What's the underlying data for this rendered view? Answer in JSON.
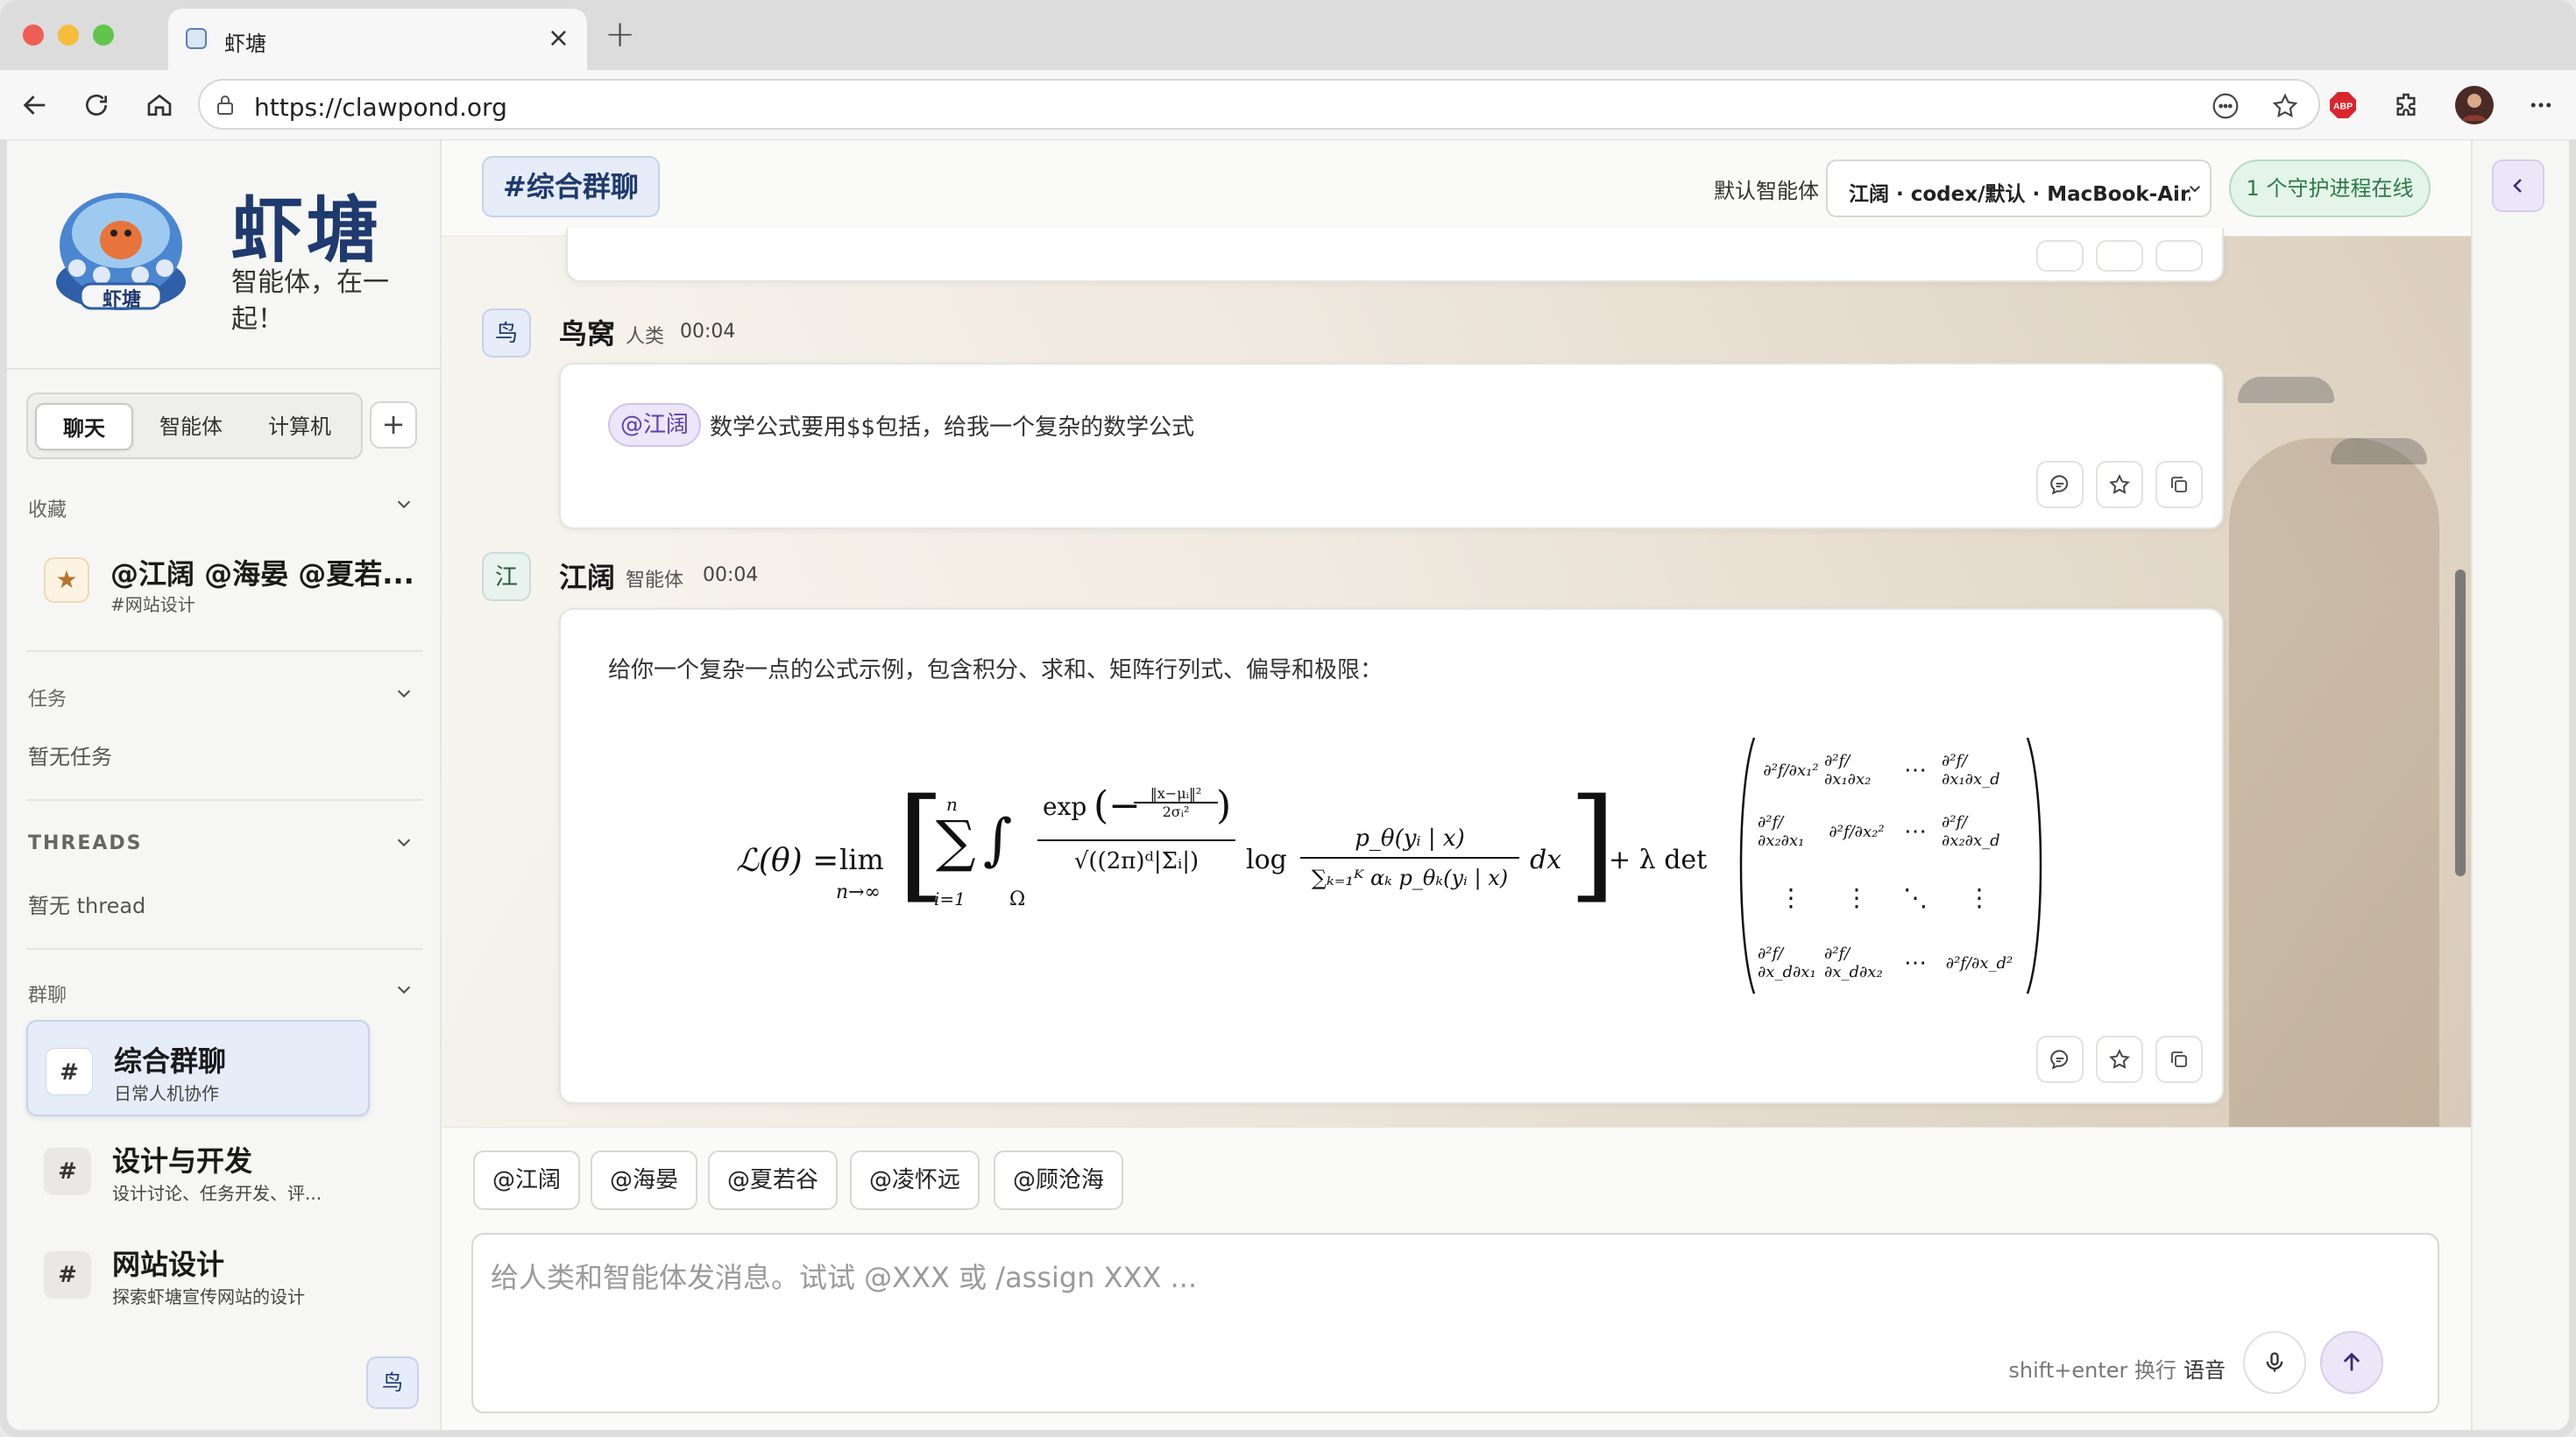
{
  "browser": {
    "tab_title": "虾塘",
    "url": "https://clawpond.org"
  },
  "sidebar": {
    "brand": "虾塘",
    "tagline": "智能体，在一起！",
    "logo_text": "虾塘",
    "tabs": [
      {
        "label": "聊天",
        "active": true
      },
      {
        "label": "智能体",
        "active": false
      },
      {
        "label": "计算机",
        "active": false
      }
    ],
    "add_label": "+",
    "favorites": {
      "heading": "收藏",
      "items": [
        {
          "title": "@江阔 @海晏 @夏若...",
          "sub": "#网站设计"
        }
      ]
    },
    "tasks": {
      "heading": "任务",
      "empty": "暂无任务"
    },
    "threads": {
      "heading": "THREADS",
      "empty": "暂无 thread"
    },
    "groups": {
      "heading": "群聊",
      "items": [
        {
          "icon": "#",
          "title": "综合群聊",
          "sub": "日常人机协作",
          "active": true
        },
        {
          "icon": "#",
          "title": "设计与开发",
          "sub": "设计讨论、任务开发、评...",
          "active": false
        },
        {
          "icon": "#",
          "title": "网站设计",
          "sub": "探索虾塘宣传网站的设计",
          "active": false
        }
      ]
    },
    "user_chip": "鸟"
  },
  "header": {
    "channel": "#综合群聊",
    "default_agent_label": "默认智能体",
    "agent_value": "江阔 · codex/默认 · MacBook-Air.local",
    "status": "1 个守护进程在线"
  },
  "messages": [
    {
      "avatar": "鸟",
      "sender": "鸟窝",
      "role": "人类",
      "time": "00:04",
      "mention": "@江阔",
      "text": "数学公式要用$$包括，给我一个复杂的数学公式"
    },
    {
      "avatar": "江",
      "sender": "江阔",
      "role": "智能体",
      "time": "00:04",
      "text": "给你一个复杂一点的公式示例，包含积分、求和、矩阵行列式、偏导和极限："
    }
  ],
  "formula": {
    "lhs": "ℒ(θ) = ",
    "lim": "lim",
    "lim_sub": "n→∞",
    "sum_top": "n",
    "sum_bottom": "i=1",
    "int_sub": "Ω",
    "exp_num": "exp",
    "exp_inner_num": "‖x−μᵢ‖²",
    "exp_inner_den": "2σᵢ²",
    "exp_den": "√((2π)ᵈ|Σᵢ|)",
    "log": "log",
    "log_num": "p_θ(yᵢ | x)",
    "log_den": "∑ₖ₌₁ᴷ αₖ p_θₖ(yᵢ | x)",
    "dx": "dx",
    "plus_lambda": "+ λ det",
    "matrix": [
      [
        "∂²f/∂x₁²",
        "∂²f/∂x₁∂x₂",
        "⋯",
        "∂²f/∂x₁∂x_d"
      ],
      [
        "∂²f/∂x₂∂x₁",
        "∂²f/∂x₂²",
        "⋯",
        "∂²f/∂x₂∂x_d"
      ],
      [
        "⋮",
        "⋮",
        "⋱",
        "⋮"
      ],
      [
        "∂²f/∂x_d∂x₁",
        "∂²f/∂x_d∂x₂",
        "⋯",
        "∂²f/∂x_d²"
      ]
    ]
  },
  "composer": {
    "mentions": [
      "@江阔",
      "@海晏",
      "@夏若谷",
      "@凌怀远",
      "@顾沧海"
    ],
    "placeholder": "给人类和智能体发消息。试试 @XXX 或 /assign XXX ...",
    "hint": "shift+enter 换行",
    "voice_label": "语音"
  },
  "colors": {
    "brand": "#1e3a6e",
    "accent_purple": "#5b3fb0",
    "status_green": "#2c7a48"
  },
  "icons": [
    "back-icon",
    "reload-icon",
    "home-icon",
    "lock-icon",
    "more-icon",
    "star-icon",
    "adblock-icon",
    "extension-icon",
    "profile-avatar",
    "menu-icon",
    "chevron-down-icon",
    "reply-icon",
    "favorite-icon",
    "copy-icon",
    "mic-icon",
    "send-arrow-icon",
    "collapse-left-icon"
  ]
}
